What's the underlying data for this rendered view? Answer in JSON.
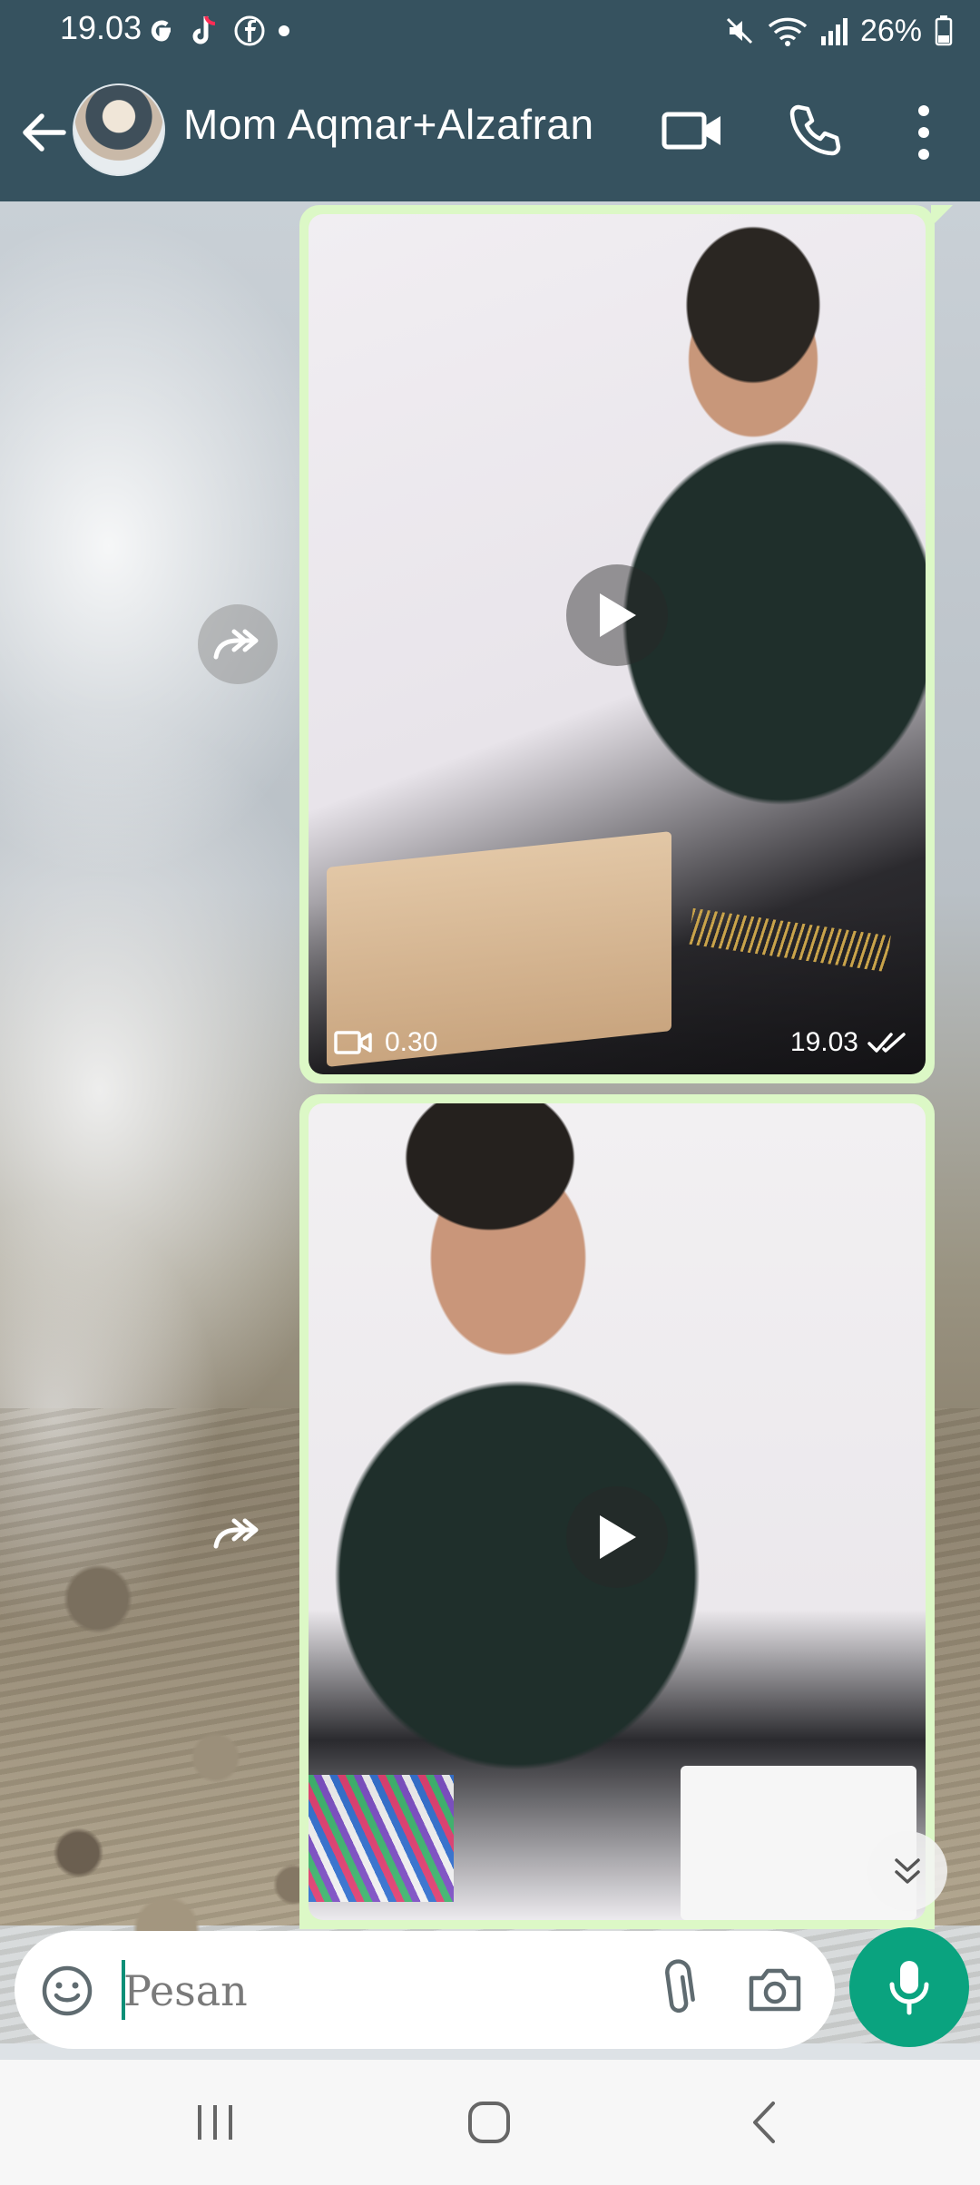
{
  "status_bar": {
    "time": "19.03",
    "battery": "26%",
    "icons": [
      "google-icon",
      "tiktok-icon",
      "facebook-icon",
      "dot-icon",
      "mute-icon",
      "wifi-icon",
      "signal-icon",
      "battery-icon"
    ]
  },
  "header": {
    "contact_name": "Mom Aqmar+Alzafran",
    "icons": [
      "back-arrow-icon",
      "video-call-icon",
      "phone-icon",
      "more-vert-icon"
    ]
  },
  "messages": [
    {
      "type": "video",
      "duration": "0.30",
      "time": "19.03",
      "status": "read"
    },
    {
      "type": "video"
    }
  ],
  "composer": {
    "placeholder": "Pesan",
    "icons": [
      "emoji-icon",
      "attach-icon",
      "camera-icon",
      "mic-icon"
    ]
  },
  "colors": {
    "header": "#36525f",
    "bubble": "#dcf8c6",
    "accent": "#0aa37f"
  }
}
